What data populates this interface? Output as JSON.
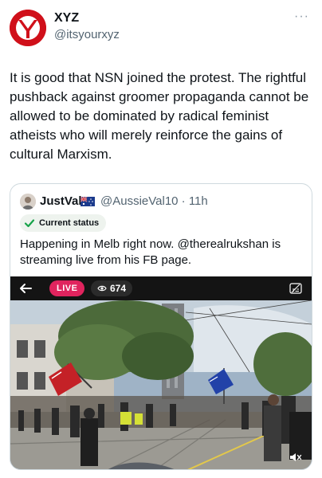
{
  "author": {
    "display_name": "XYZ",
    "handle": "@itsyourxyz",
    "avatar_icon": "y-logo-icon"
  },
  "menu": {
    "more_label": "···"
  },
  "tweet": {
    "text": "It is good that NSN joined the protest. The rightful pushback against groomer propaganda cannot be allowed to be dominated by radical feminist atheists who will merely reinforce the gains of cultural Marxism."
  },
  "quote": {
    "display_name": "JustVal",
    "flag_icon": "australian-flag-icon",
    "handle_time": "@AussieVal10 · 11h",
    "status_label": "Current status",
    "text": "Happening in Melb right now. @therealrukshan is streaming live from his FB page."
  },
  "video": {
    "live_label": "LIVE",
    "viewer_count": "674",
    "icons": [
      "back-arrow-icon",
      "eye-icon",
      "captions-icon",
      "mute-icon"
    ]
  },
  "colors": {
    "brand_red": "#d0101a",
    "live_red": "#e0245e",
    "secondary_text": "#536471",
    "border": "#cfd9de"
  }
}
